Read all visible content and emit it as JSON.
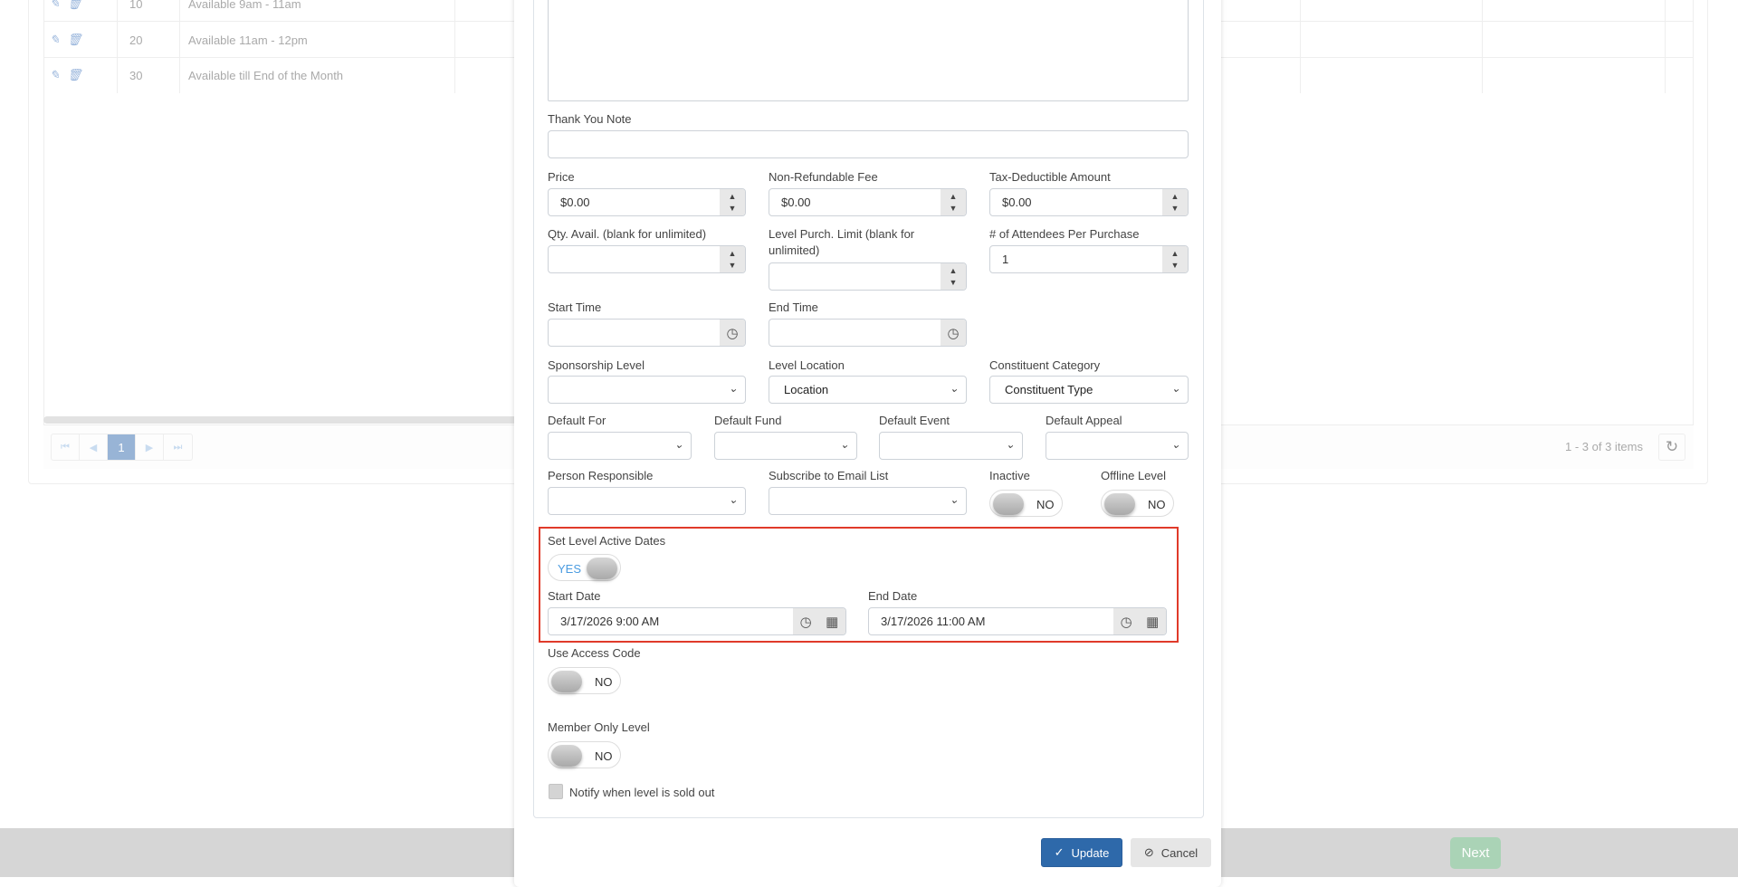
{
  "table": {
    "rows": [
      {
        "sort": "10",
        "description": "Available 9am - 11am"
      },
      {
        "sort": "20",
        "description": "Available 11am - 12pm"
      },
      {
        "sort": "30",
        "description": "Available till End of the Month"
      }
    ],
    "pager": {
      "current_page": "1",
      "items_text": "1 - 3 of 3 items"
    }
  },
  "footer": {
    "next_label": "Next"
  },
  "form": {
    "thank_you_note": {
      "label": "Thank You Note",
      "value": ""
    },
    "price": {
      "label": "Price",
      "value": "$0.00"
    },
    "non_refundable_fee": {
      "label": "Non-Refundable Fee",
      "value": "$0.00"
    },
    "tax_deductible": {
      "label": "Tax-Deductible Amount",
      "value": "$0.00"
    },
    "qty_avail": {
      "label": "Qty. Avail. (blank for unlimited)",
      "value": ""
    },
    "purch_limit": {
      "label_line1": "Level Purch. Limit (blank for",
      "label_line2": "unlimited)",
      "value": ""
    },
    "attendees": {
      "label": "# of Attendees Per Purchase",
      "value": "1"
    },
    "start_time": {
      "label": "Start Time",
      "value": ""
    },
    "end_time": {
      "label": "End Time",
      "value": ""
    },
    "sponsorship_level": {
      "label": "Sponsorship Level",
      "value": ""
    },
    "level_location": {
      "label": "Level Location",
      "value": "Location"
    },
    "constituent_category": {
      "label": "Constituent Category",
      "value": "Constituent Type"
    },
    "default_for": {
      "label": "Default For",
      "value": ""
    },
    "default_fund": {
      "label": "Default Fund",
      "value": ""
    },
    "default_event": {
      "label": "Default Event",
      "value": ""
    },
    "default_appeal": {
      "label": "Default Appeal",
      "value": ""
    },
    "person_responsible": {
      "label": "Person Responsible",
      "value": ""
    },
    "subscribe_email": {
      "label": "Subscribe to Email List",
      "value": ""
    },
    "inactive": {
      "label": "Inactive",
      "state": "NO"
    },
    "offline_level": {
      "label": "Offline Level",
      "state": "NO"
    },
    "set_active_dates": {
      "label": "Set Level Active Dates",
      "state": "YES"
    },
    "start_date": {
      "label": "Start Date",
      "value": "3/17/2026 9:00 AM"
    },
    "end_date": {
      "label": "End Date",
      "value": "3/17/2026 11:00 AM"
    },
    "use_access_code": {
      "label": "Use Access Code",
      "state": "NO"
    },
    "member_only": {
      "label": "Member Only Level",
      "state": "NO"
    },
    "notify_sold_out": {
      "label": "Notify when level is sold out",
      "checked": false
    }
  },
  "actions": {
    "update_label": "Update",
    "cancel_label": "Cancel"
  },
  "colors": {
    "primary": "#2e69aa",
    "highlight_border": "#e03a2a",
    "toggle_on_text": "#4a9be0",
    "next_button": "#aad3b6"
  }
}
